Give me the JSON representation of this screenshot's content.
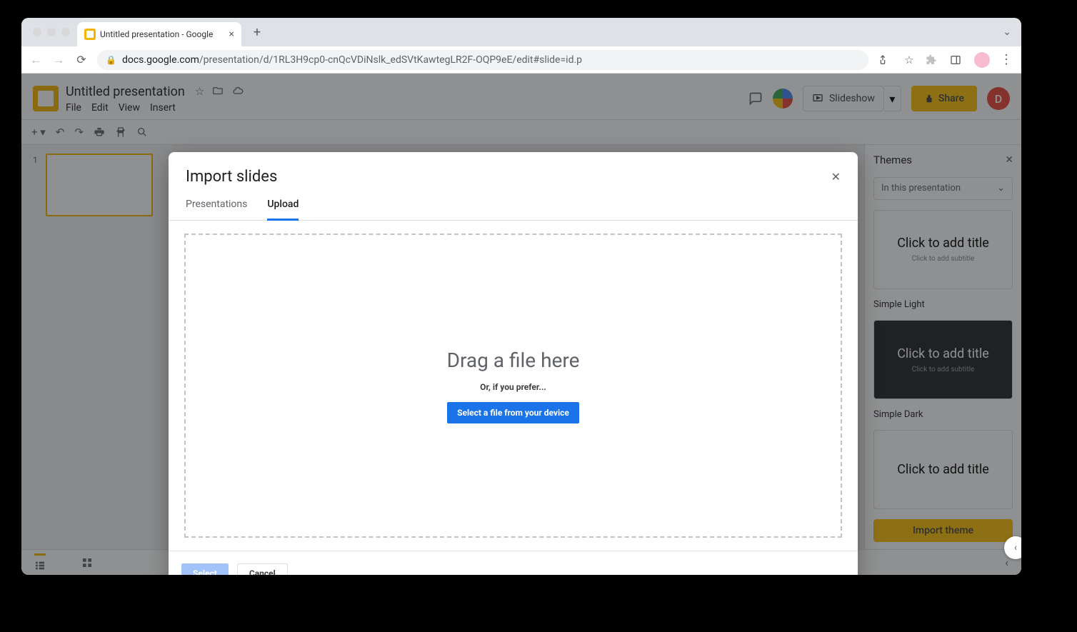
{
  "browser": {
    "tab_title": "Untitled presentation - Google",
    "url_host": "docs.google.com",
    "url_path": "/presentation/d/1RL3H9cp0-cnQcVDiNslk_edSVtKawtegLR2F-OQP9eE/edit#slide=id.p"
  },
  "app": {
    "doc_title": "Untitled presentation",
    "menus": [
      "File",
      "Edit",
      "View",
      "Insert"
    ],
    "slideshow_label": "Slideshow",
    "share_label": "Share",
    "user_initial": "D"
  },
  "filmstrip": {
    "slides": [
      {
        "number": "1"
      }
    ]
  },
  "themes": {
    "panel_title": "Themes",
    "dropdown_value": "In this presentation",
    "theme1": {
      "title": "Click to add title",
      "subtitle": "Click to add subtitle",
      "label": "Simple Light"
    },
    "theme2": {
      "title": "Click to add title",
      "subtitle": "Click to add subtitle",
      "label": "Simple Dark"
    },
    "theme3": {
      "title": "Click to add title"
    },
    "import_label": "Import theme"
  },
  "modal": {
    "title": "Import slides",
    "tabs": {
      "presentations": "Presentations",
      "upload": "Upload"
    },
    "dropzone": {
      "title": "Drag a file here",
      "subtitle": "Or, if you prefer...",
      "button": "Select a file from your device"
    },
    "footer": {
      "select": "Select",
      "cancel": "Cancel"
    }
  }
}
